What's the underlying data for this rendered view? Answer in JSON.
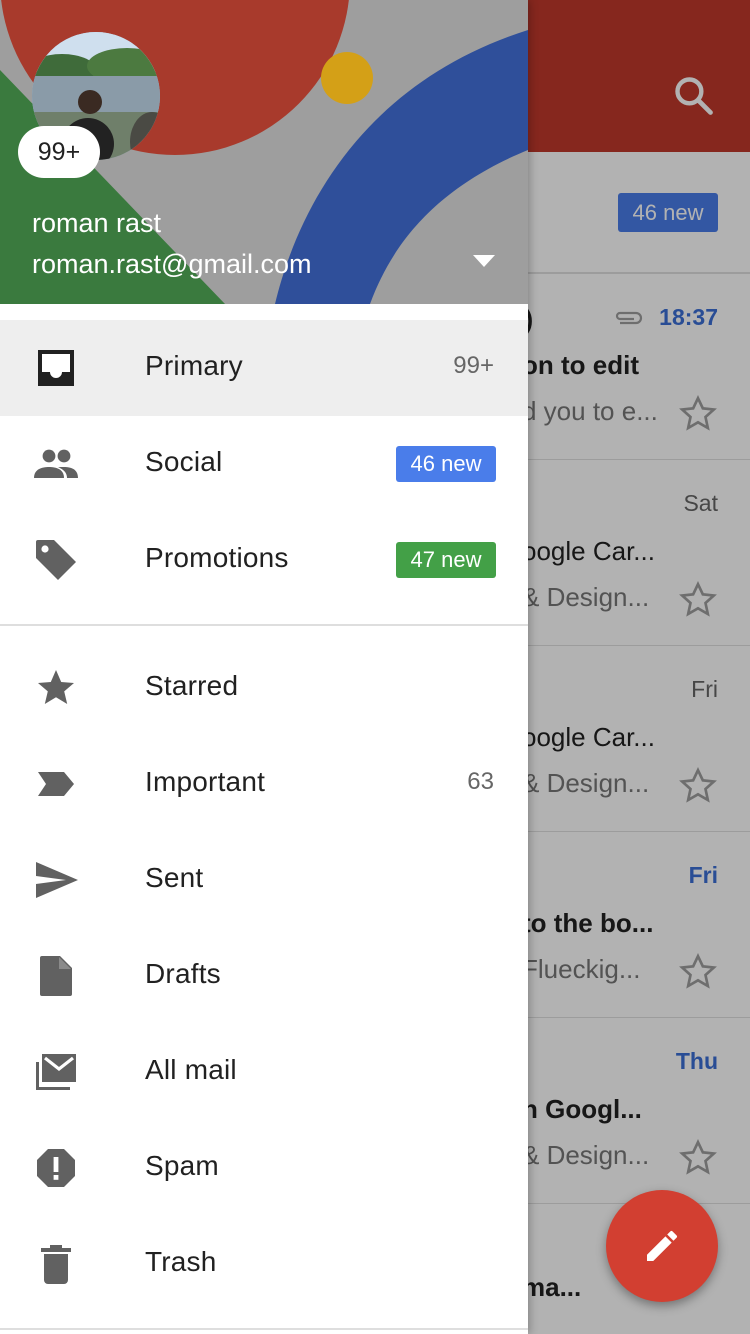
{
  "account": {
    "name": "roman rast",
    "email": "roman.rast@gmail.com",
    "notification_count": "99+"
  },
  "categories": [
    {
      "label": "Primary",
      "count": "99+",
      "icon": "inbox-icon"
    },
    {
      "label": "Social",
      "badge": "46 new",
      "badge_color": "#4a7dea",
      "icon": "people-icon"
    },
    {
      "label": "Promotions",
      "badge": "47 new",
      "badge_color": "#43a047",
      "icon": "tag-icon"
    }
  ],
  "folders": [
    {
      "label": "Starred",
      "icon": "star-icon"
    },
    {
      "label": "Important",
      "count": "63",
      "icon": "important-icon"
    },
    {
      "label": "Sent",
      "icon": "send-icon"
    },
    {
      "label": "Drafts",
      "icon": "draft-icon"
    },
    {
      "label": "All mail",
      "icon": "all-mail-icon"
    },
    {
      "label": "Spam",
      "icon": "spam-icon"
    },
    {
      "label": "Trash",
      "icon": "trash-icon"
    }
  ],
  "background": {
    "banner_badge": "46 new",
    "emails": [
      {
        "sender": "s)",
        "time": "18:37",
        "subject": "on to edit",
        "snippet": "d you to e...",
        "unread": true,
        "attachment": true
      },
      {
        "sender": "",
        "time": "Sat",
        "subject": "oogle Car...",
        "snippet": "& Design...",
        "unread": false
      },
      {
        "sender": "",
        "time": "Fri",
        "subject": "oogle Car...",
        "snippet": "& Design...",
        "unread": false
      },
      {
        "sender": "",
        "time": "Fri",
        "subject": "to the bo...",
        "snippet": "Flueckig...",
        "unread": true
      },
      {
        "sender": "",
        "time": "Thu",
        "subject": "n Googl...",
        "snippet": "& Design...",
        "unread": true
      },
      {
        "sender": "",
        "time": "",
        "subject": "ma...",
        "snippet": "",
        "unread": false
      }
    ]
  },
  "colors": {
    "appbar": "#c0392b",
    "header_red": "#a83a2c",
    "header_green": "#3a7a3e",
    "header_blue": "#2f4f9a",
    "header_yellow": "#d4a017",
    "icon_grey": "#616161"
  }
}
